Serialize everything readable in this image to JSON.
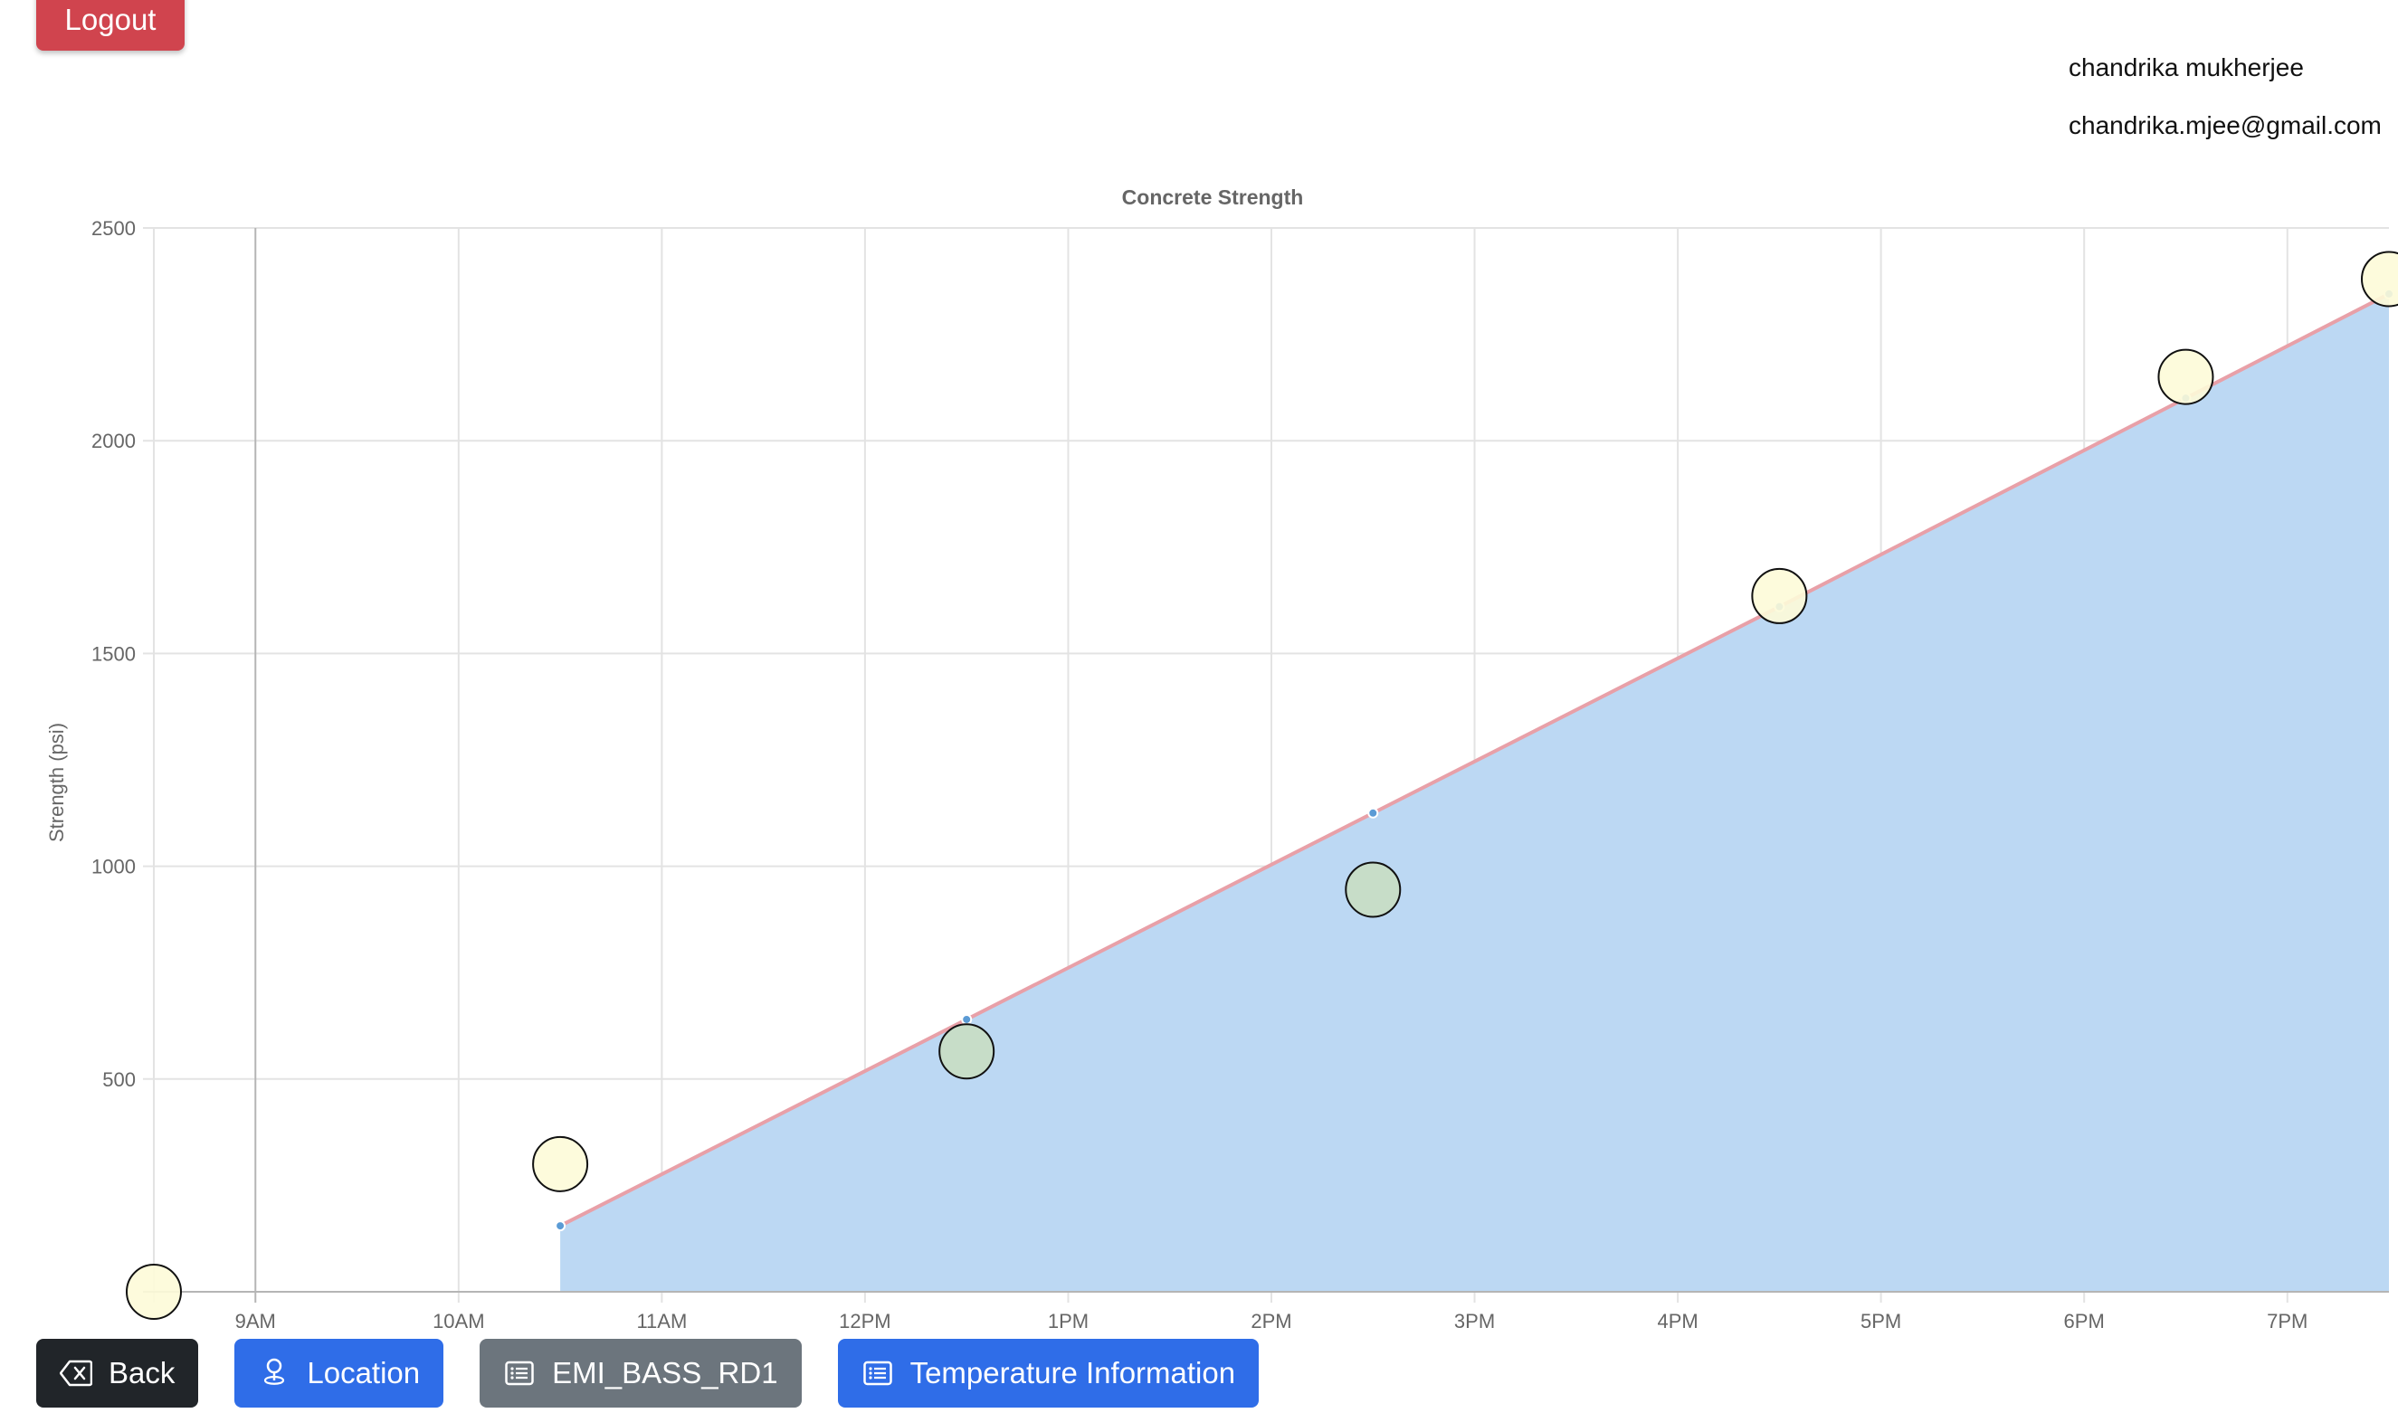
{
  "header": {
    "logout_label": "Logout",
    "user_name": "chandrika mukherjee",
    "user_email": "chandrika.mjee@gmail.com"
  },
  "toolbar": {
    "back_label": "Back",
    "location_label": "Location",
    "sensor_label": "EMI_BASS_RD1",
    "temperature_label": "Temperature Information",
    "icons": {
      "back": "backspace-icon",
      "location": "person-pin-icon",
      "sensor": "list-card-icon",
      "temperature": "list-card-icon"
    },
    "colors": {
      "back": "#212529",
      "location": "#2f6de8",
      "sensor": "#6c757d",
      "temperature": "#2f6de8"
    }
  },
  "chart_data": {
    "type": "line",
    "title": "Concrete Strength",
    "xlabel": "",
    "ylabel": "Strength (psi)",
    "xlim": [
      "8:30AM",
      "7:30PM"
    ],
    "ylim": [
      0,
      2500
    ],
    "x_ticks": [
      "9AM",
      "10AM",
      "11AM",
      "12PM",
      "1PM",
      "2PM",
      "3PM",
      "4PM",
      "5PM",
      "6PM",
      "7PM"
    ],
    "y_ticks": [
      500,
      1000,
      1500,
      2000,
      2500
    ],
    "grid": true,
    "legend": "none",
    "series": [
      {
        "kind": "area-line",
        "color": "#e8a0a8",
        "fill": "#bcd8f3",
        "marker_color": "#5b9bd5",
        "x": [
          "10:30AM",
          "12:30PM",
          "2:30PM",
          "4:30PM",
          "6:30PM",
          "7:30PM"
        ],
        "values": [
          155,
          640,
          1125,
          1610,
          2100,
          2345
        ]
      },
      {
        "kind": "bubble",
        "stroke": "#111111",
        "points": [
          {
            "x": "8:30AM",
            "y": 0,
            "fill": "#fdfbd8"
          },
          {
            "x": "10:30AM",
            "y": 300,
            "fill": "#fdfbd8"
          },
          {
            "x": "12:30PM",
            "y": 565,
            "fill": "#c8dec3"
          },
          {
            "x": "2:30PM",
            "y": 945,
            "fill": "#c8dec3"
          },
          {
            "x": "4:30PM",
            "y": 1635,
            "fill": "#fdfbd8"
          },
          {
            "x": "6:30PM",
            "y": 2150,
            "fill": "#fdfbd8"
          },
          {
            "x": "7:30PM",
            "y": 2380,
            "fill": "#fdfbd8"
          }
        ]
      }
    ]
  }
}
